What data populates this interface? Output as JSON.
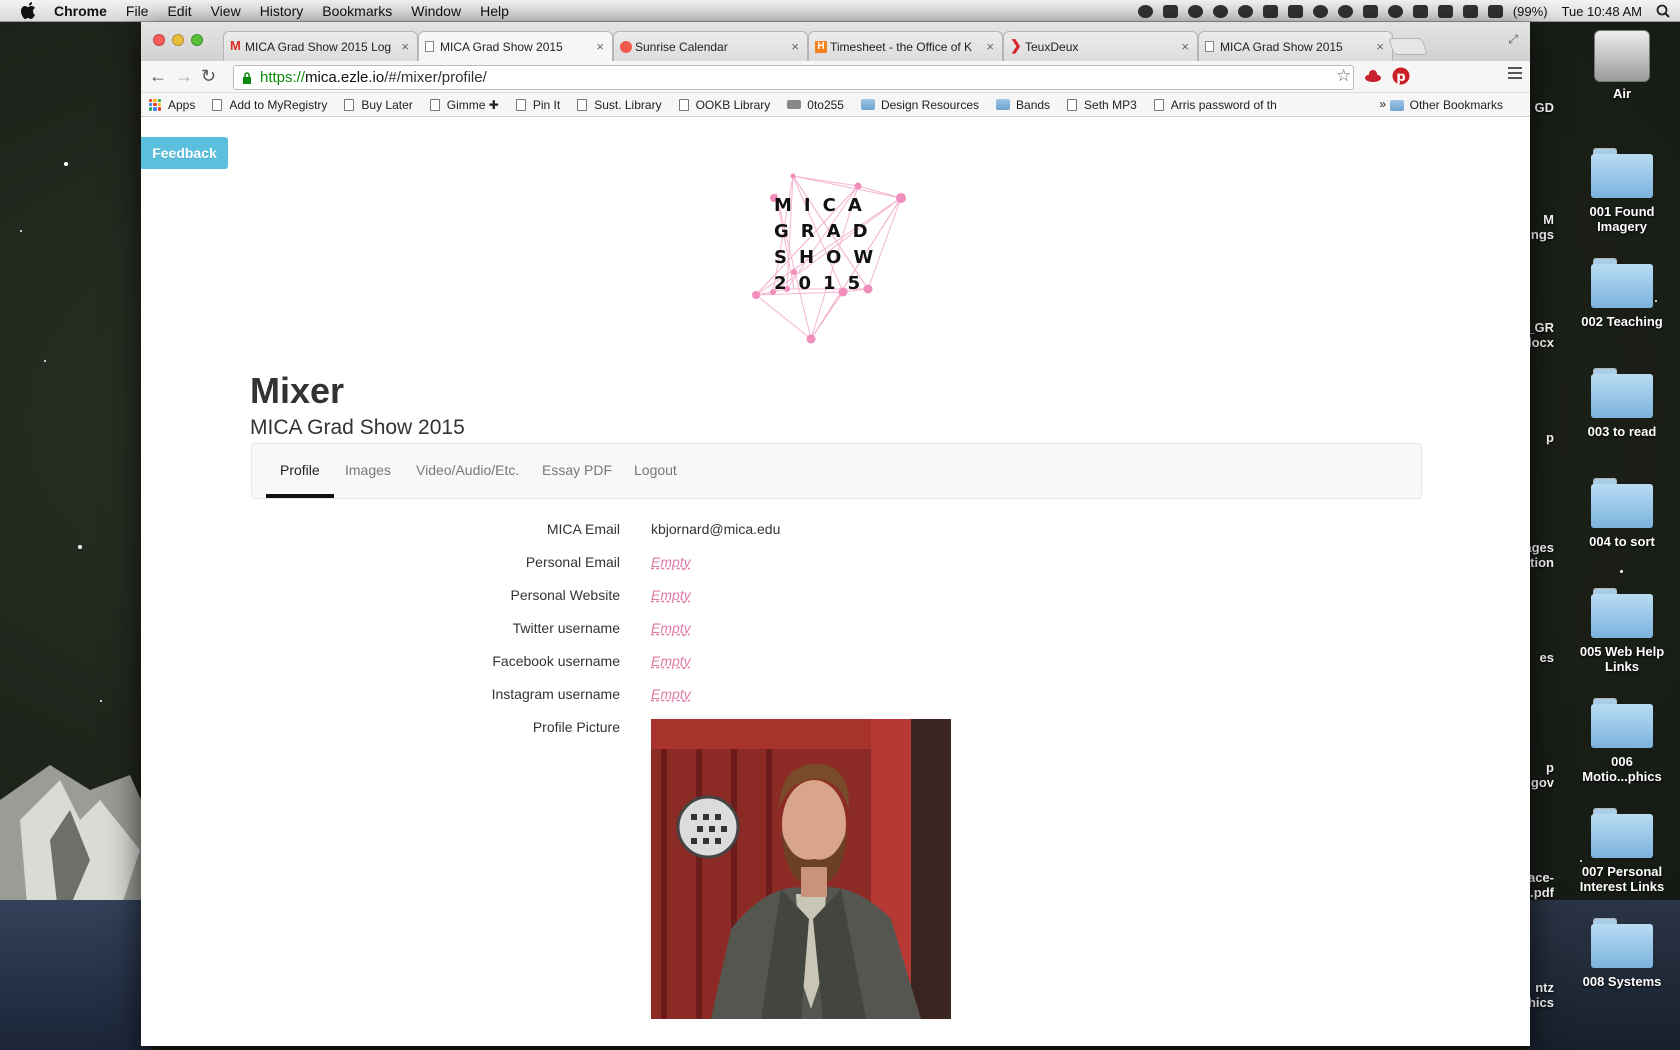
{
  "menubar": {
    "app": "Chrome",
    "items": [
      "File",
      "Edit",
      "View",
      "History",
      "Bookmarks",
      "Window",
      "Help"
    ],
    "battery": "(99%)",
    "clock": "Tue 10:48 AM"
  },
  "desktop": {
    "drive_label": "Air",
    "folders": [
      "001 Found Imagery",
      "002 Teaching",
      "003 to read",
      "004 to sort",
      "005 Web Help Links",
      "006 Motio...phics",
      "007 Personal Interest Links",
      "008 Systems"
    ],
    "partial_labels": [
      "GD",
      "M\nngs",
      "_GR\ndocx",
      "p",
      "ages\nation",
      "es",
      "p\n.gov",
      "ace-\n.pdf",
      "ntz\nhics"
    ]
  },
  "browser": {
    "tabs": [
      {
        "title": "MICA Grad Show 2015 Log",
        "favicon": "gmail-icon"
      },
      {
        "title": "MICA Grad Show 2015",
        "favicon": "page-icon"
      },
      {
        "title": "Sunrise Calendar",
        "favicon": "sunrise-icon"
      },
      {
        "title": "Timesheet - the Office of K",
        "favicon": "harvest-icon"
      },
      {
        "title": "TeuxDeux",
        "favicon": "teuxdeux-icon"
      },
      {
        "title": "MICA Grad Show 2015",
        "favicon": "page-icon"
      }
    ],
    "url": {
      "scheme": "https://",
      "host": "mica.ezle.io",
      "path": "/#/mixer/profile/"
    },
    "bookmarks": [
      "Apps",
      "Add to MyRegistry",
      "Buy Later",
      "Gimme ✚",
      "Pin It",
      "Sust. Library",
      "OOKB Library",
      "0to255",
      "Design Resources",
      "Bands",
      "Seth MP3",
      "Arris password of th"
    ],
    "overflow": "»",
    "other_bookmarks": "Other Bookmarks"
  },
  "page": {
    "feedback": "Feedback",
    "logo_lines": [
      "MICA",
      "GRAD",
      "SHOW",
      "2015"
    ],
    "title": "Mixer",
    "subtitle": "MICA Grad Show 2015",
    "nav": [
      "Profile",
      "Images",
      "Video/Audio/Etc.",
      "Essay PDF",
      "Logout"
    ],
    "active_nav": "Profile",
    "fields": [
      {
        "label": "MICA Email",
        "value": "kbjornard@mica.edu",
        "empty": false
      },
      {
        "label": "Personal Email",
        "value": "Empty",
        "empty": true
      },
      {
        "label": "Personal Website",
        "value": "Empty",
        "empty": true
      },
      {
        "label": "Twitter username",
        "value": "Empty",
        "empty": true
      },
      {
        "label": "Facebook username",
        "value": "Empty",
        "empty": true
      },
      {
        "label": "Instagram username",
        "value": "Empty",
        "empty": true
      },
      {
        "label": "Profile Picture",
        "value": "",
        "empty": false
      }
    ],
    "accent_color": "#e07aa6",
    "feedback_color": "#5bc0de"
  }
}
